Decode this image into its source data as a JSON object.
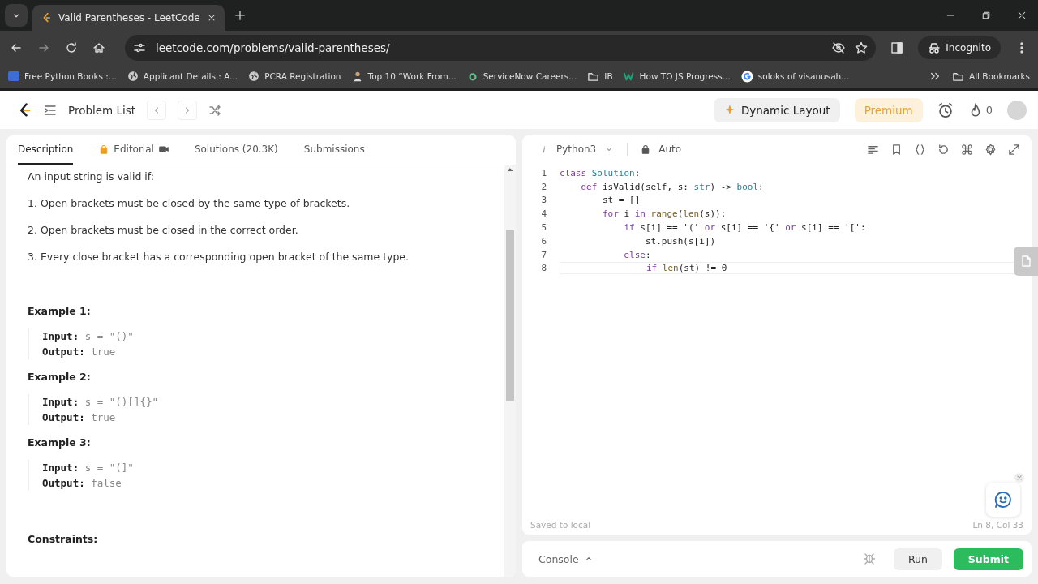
{
  "browser": {
    "tab_title": "Valid Parentheses - LeetCode",
    "url": "leetcode.com/problems/valid-parentheses/",
    "profile": "Incognito",
    "bookmarks": [
      {
        "label": "Free Python Books :...",
        "kind": "badge"
      },
      {
        "label": "Applicant Details : A...",
        "kind": "globe"
      },
      {
        "label": "PCRA Registration",
        "kind": "globe"
      },
      {
        "label": "Top 10 “Work From...",
        "kind": "person"
      },
      {
        "label": "ServiceNow Careers...",
        "kind": "ring"
      },
      {
        "label": "IB",
        "kind": "folder"
      },
      {
        "label": "How TO JS Progress...",
        "kind": "w"
      },
      {
        "label": "soloks of visanusah...",
        "kind": "g"
      }
    ],
    "all_bookmarks": "All Bookmarks"
  },
  "header": {
    "problem_list": "Problem List",
    "layout_button": "Dynamic Layout",
    "premium": "Premium",
    "streak": "0"
  },
  "tabs": [
    {
      "label": "Description",
      "selected": true,
      "locked": false
    },
    {
      "label": "Editorial",
      "selected": false,
      "locked": true
    },
    {
      "label": "Solutions (20.3K)",
      "selected": false,
      "locked": false
    },
    {
      "label": "Submissions",
      "selected": false,
      "locked": false
    }
  ],
  "description": {
    "intro": "An input string is valid if:",
    "rules": [
      "1. Open brackets must be closed by the same type of brackets.",
      "2. Open brackets must be closed in the correct order.",
      "3. Every close bracket has a corresponding open bracket of the same type."
    ],
    "examples": [
      {
        "title": "Example 1:",
        "input_label": "Input:",
        "input": "s = \"()\"",
        "output_label": "Output:",
        "output": "true"
      },
      {
        "title": "Example 2:",
        "input_label": "Input:",
        "input": "s = \"()[]{}\"",
        "output_label": "Output:",
        "output": "true"
      },
      {
        "title": "Example 3:",
        "input_label": "Input:",
        "input": "s = \"(]\"",
        "output_label": "Output:",
        "output": "false"
      }
    ],
    "constraints_title": "Constraints:"
  },
  "editor": {
    "language": "Python3",
    "mode": "Auto",
    "lines": [
      {
        "number": "1",
        "segments": [
          {
            "text": "class ",
            "kind": "kw"
          },
          {
            "text": "Solution",
            "kind": "type"
          },
          {
            "text": ":",
            "kind": "plain"
          }
        ]
      },
      {
        "number": "2",
        "segments": [
          {
            "text": "    def",
            "kind": "kw"
          },
          {
            "text": " isValid(self, s: ",
            "kind": "plain"
          },
          {
            "text": "str",
            "kind": "type"
          },
          {
            "text": ") -> ",
            "kind": "plain"
          },
          {
            "text": "bool",
            "kind": "type"
          },
          {
            "text": ":",
            "kind": "plain"
          }
        ]
      },
      {
        "number": "3",
        "segments": [
          {
            "text": "        st = []",
            "kind": "plain"
          }
        ]
      },
      {
        "number": "4",
        "segments": [
          {
            "text": "        for",
            "kind": "kw"
          },
          {
            "text": " i ",
            "kind": "plain"
          },
          {
            "text": "in ",
            "kind": "kw"
          },
          {
            "text": "range",
            "kind": "fn"
          },
          {
            "text": "(",
            "kind": "plain"
          },
          {
            "text": "len",
            "kind": "fn"
          },
          {
            "text": "(s)):",
            "kind": "plain"
          }
        ]
      },
      {
        "number": "5",
        "segments": [
          {
            "text": "            if",
            "kind": "kw"
          },
          {
            "text": " s[i] == '(' ",
            "kind": "plain"
          },
          {
            "text": "or",
            "kind": "kw"
          },
          {
            "text": " s[i] == '{' ",
            "kind": "plain"
          },
          {
            "text": "or",
            "kind": "kw"
          },
          {
            "text": " s[i] == '[':",
            "kind": "plain"
          }
        ]
      },
      {
        "number": "6",
        "segments": [
          {
            "text": "                st.push(s[i])",
            "kind": "plain"
          }
        ]
      },
      {
        "number": "7",
        "segments": [
          {
            "text": "            else",
            "kind": "kw"
          },
          {
            "text": ":",
            "kind": "plain"
          }
        ]
      },
      {
        "number": "8",
        "segments": [
          {
            "text": "                if ",
            "kind": "kw"
          },
          {
            "text": "len",
            "kind": "fn"
          },
          {
            "text": "(st) != 0",
            "kind": "plain"
          }
        ]
      }
    ],
    "saved": "Saved to local",
    "cursor": "Ln 8, Col 33"
  },
  "console": {
    "label": "Console",
    "run": "Run",
    "submit": "Submit"
  }
}
